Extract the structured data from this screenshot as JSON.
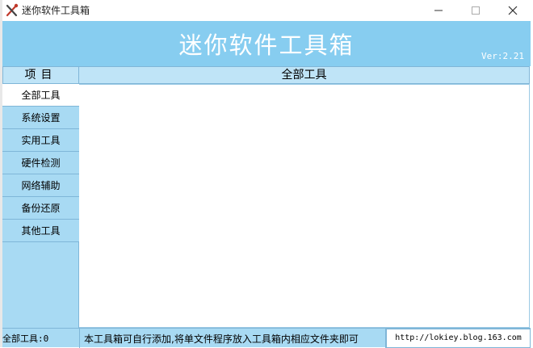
{
  "window": {
    "title": "迷你软件工具箱",
    "icon": "tools-icon",
    "controls": {
      "minimize": "minimize-icon",
      "maximize": "maximize-icon",
      "close": "close-icon"
    }
  },
  "banner": {
    "title": "迷你软件工具箱",
    "version": "Ver:2.21",
    "color": "#87cdf0"
  },
  "sidebar": {
    "header": "项目",
    "items": [
      {
        "label": "全部工具",
        "active": true
      },
      {
        "label": "系统设置",
        "active": false
      },
      {
        "label": "实用工具",
        "active": false
      },
      {
        "label": "硬件检测",
        "active": false
      },
      {
        "label": "网络辅助",
        "active": false
      },
      {
        "label": "备份还原",
        "active": false
      },
      {
        "label": "其他工具",
        "active": false
      }
    ]
  },
  "content": {
    "header": "全部工具"
  },
  "status": {
    "count": "全部工具:0",
    "message": "本工具箱可自行添加,将单文件程序放入工具箱内相应文件夹即可",
    "url": "http://lokiey.blog.163.com"
  }
}
